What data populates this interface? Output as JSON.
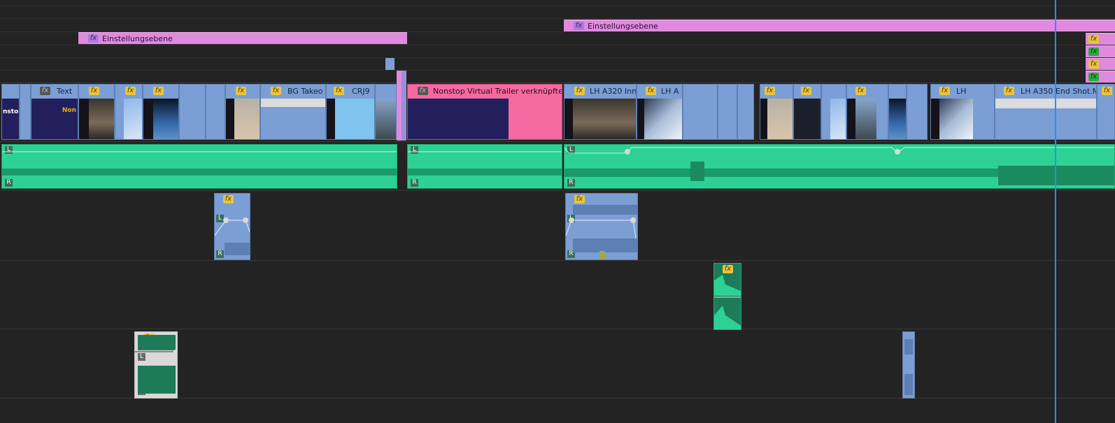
{
  "adjustment_clips": [
    {
      "label": "Einstellungsebene",
      "fx": "fx"
    },
    {
      "label": "Einstellungsebene",
      "fx": "fx"
    }
  ],
  "stacked_fx": [
    "fx",
    "fx",
    "fx",
    "fx"
  ],
  "video_clips": [
    {
      "name": "nstop",
      "fx": ""
    },
    {
      "name": "Text",
      "fx": "fx"
    },
    {
      "name": "",
      "fx": "fx"
    },
    {
      "name": "",
      "fx": "fx"
    },
    {
      "name": "",
      "fx": "fx"
    },
    {
      "name": "",
      "fx": "fx"
    },
    {
      "name": "BG Takeo",
      "fx": "fx"
    },
    {
      "name": "CRJ9",
      "fx": "fx"
    },
    {
      "name": "Nonstop Virtual Trailer verknüpfte",
      "fx": "fx"
    },
    {
      "name": "LH A320 Inn",
      "fx": "fx"
    },
    {
      "name": "LH A",
      "fx": "fx"
    },
    {
      "name": "",
      "fx": "fx"
    },
    {
      "name": "",
      "fx": "fx"
    },
    {
      "name": "",
      "fx": "fx"
    },
    {
      "name": "LH",
      "fx": "fx"
    },
    {
      "name": "LH A350 End Shot.M",
      "fx": "fx"
    },
    {
      "name": "",
      "fx": "fx"
    }
  ],
  "thumb_text": "Non",
  "audio_channels": {
    "left": "L",
    "right": "R"
  },
  "audio_fx": "fx",
  "colors": {
    "background": "#232323",
    "adjustment": "#e08ade",
    "video": "#7b9fd4",
    "audio": "#2ed195",
    "playhead": "#2f8cf0",
    "nested": "#f46aa0"
  }
}
